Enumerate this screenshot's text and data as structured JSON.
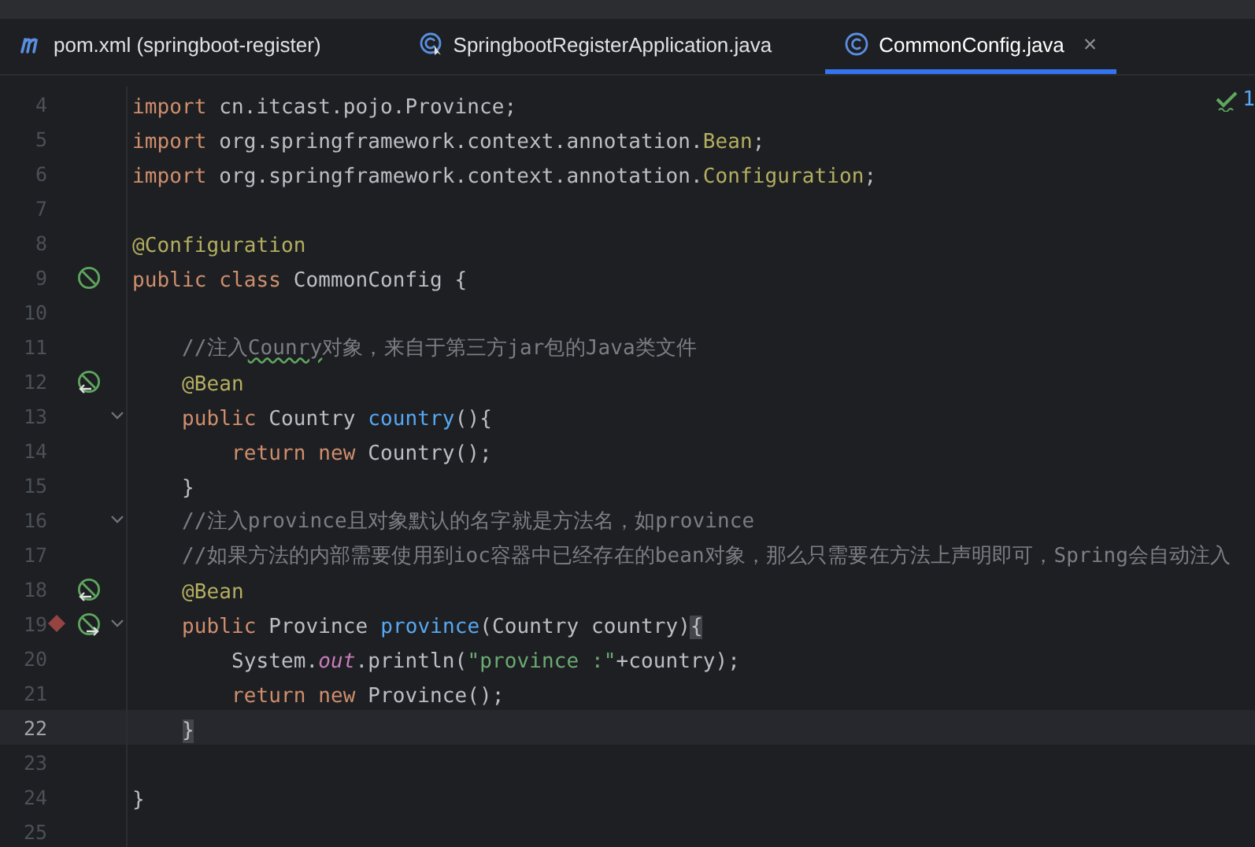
{
  "tabs": [
    {
      "label": "pom.xml (springboot-register)",
      "kind": "maven",
      "selected": false,
      "closable": false
    },
    {
      "label": "SpringbootRegisterApplication.java",
      "kind": "application",
      "selected": false,
      "closable": false
    },
    {
      "label": "CommonConfig.java",
      "kind": "class",
      "selected": true,
      "closable": true
    }
  ],
  "close_glyph": "×",
  "inspection": {
    "count": "1"
  },
  "lines": [
    {
      "number": "4",
      "current": false,
      "fold": false,
      "tokens": [
        {
          "t": "import",
          "kind": "kw"
        },
        {
          "t": " cn.itcast.pojo.Province;",
          "kind": "plain"
        }
      ]
    },
    {
      "number": "5",
      "current": false,
      "fold": false,
      "tokens": [
        {
          "t": "import",
          "kind": "kw"
        },
        {
          "t": " org.springframework.context.annotation.",
          "kind": "plain"
        },
        {
          "t": "Bean",
          "kind": "ann"
        },
        {
          "t": ";",
          "kind": "plain"
        }
      ]
    },
    {
      "number": "6",
      "current": false,
      "fold": false,
      "tokens": [
        {
          "t": "import",
          "kind": "kw"
        },
        {
          "t": " org.springframework.context.annotation.",
          "kind": "plain"
        },
        {
          "t": "Configuration",
          "kind": "ann"
        },
        {
          "t": ";",
          "kind": "plain"
        }
      ]
    },
    {
      "number": "7",
      "current": false,
      "fold": false
    },
    {
      "number": "8",
      "current": false,
      "fold": false,
      "tokens": [
        {
          "t": "@Configuration",
          "kind": "ann"
        }
      ]
    },
    {
      "number": "9",
      "current": false,
      "fold": false,
      "gutter": [
        {
          "kind": "bean"
        }
      ],
      "tokens": [
        {
          "t": "public class",
          "kind": "kw"
        },
        {
          "t": " CommonConfig {",
          "kind": "plain"
        }
      ]
    },
    {
      "number": "10",
      "current": false,
      "fold": false
    },
    {
      "number": "11",
      "current": false,
      "fold": false,
      "tokens": [
        {
          "t": "    //注入",
          "kind": "comment"
        },
        {
          "t": "Counry",
          "kind": "typo"
        },
        {
          "t": "对象，来自于第三方jar包的Java类文件",
          "kind": "comment"
        }
      ]
    },
    {
      "number": "12",
      "current": false,
      "fold": false,
      "gutter": [
        {
          "kind": "bean-in"
        }
      ],
      "tokens": [
        {
          "t": "    @Bean",
          "kind": "ann"
        }
      ]
    },
    {
      "number": "13",
      "current": false,
      "fold": true,
      "tokens": [
        {
          "t": "    public",
          "kind": "kw"
        },
        {
          "t": " Country ",
          "kind": "plain"
        },
        {
          "t": "country",
          "kind": "fn"
        },
        {
          "t": "(){",
          "kind": "plain"
        }
      ]
    },
    {
      "number": "14",
      "current": false,
      "fold": false,
      "tokens": [
        {
          "t": "        return new",
          "kind": "kw"
        },
        {
          "t": " Country();",
          "kind": "plain"
        }
      ]
    },
    {
      "number": "15",
      "current": false,
      "fold": false,
      "tokens": [
        {
          "t": "    }",
          "kind": "plain"
        }
      ]
    },
    {
      "number": "16",
      "current": false,
      "fold": true,
      "tokens": [
        {
          "t": "    //注入province且对象默认的名字就是方法名，如province",
          "kind": "comment"
        }
      ]
    },
    {
      "number": "17",
      "current": false,
      "fold": false,
      "tokens": [
        {
          "t": "    //如果方法的内部需要使用到ioc容器中已经存在的bean对象，那么只需要在方法上声明即可，Spring会自动注入",
          "kind": "comment"
        }
      ]
    },
    {
      "number": "18",
      "current": false,
      "fold": false,
      "gutter": [
        {
          "kind": "bean-in"
        }
      ],
      "tokens": [
        {
          "t": "    @Bean",
          "kind": "ann"
        }
      ]
    },
    {
      "number": "19",
      "current": false,
      "fold": true,
      "gutter": [
        {
          "kind": "breakpoint"
        },
        {
          "kind": "bean-out"
        }
      ],
      "tokens": [
        {
          "t": "    public",
          "kind": "kw"
        },
        {
          "t": " Province ",
          "kind": "plain"
        },
        {
          "t": "province",
          "kind": "fn"
        },
        {
          "t": "(Country country)",
          "kind": "plain"
        },
        {
          "t": "{",
          "kind": "match"
        }
      ]
    },
    {
      "number": "20",
      "current": false,
      "fold": false,
      "tokens": [
        {
          "t": "        System.",
          "kind": "plain"
        },
        {
          "t": "out",
          "kind": "static"
        },
        {
          "t": ".println(",
          "kind": "plain"
        },
        {
          "t": "\"province :\"",
          "kind": "str"
        },
        {
          "t": "+country);",
          "kind": "plain"
        }
      ]
    },
    {
      "number": "21",
      "current": false,
      "fold": false,
      "tokens": [
        {
          "t": "        return new",
          "kind": "kw"
        },
        {
          "t": " Province();",
          "kind": "plain"
        }
      ]
    },
    {
      "number": "22",
      "current": true,
      "fold": false,
      "tokens": [
        {
          "t": "    }",
          "kind": "match"
        }
      ]
    },
    {
      "number": "23",
      "current": false,
      "fold": false
    },
    {
      "number": "24",
      "current": false,
      "fold": false,
      "tokens": [
        {
          "t": "}",
          "kind": "plain"
        }
      ]
    },
    {
      "number": "25",
      "current": false,
      "fold": false
    }
  ]
}
